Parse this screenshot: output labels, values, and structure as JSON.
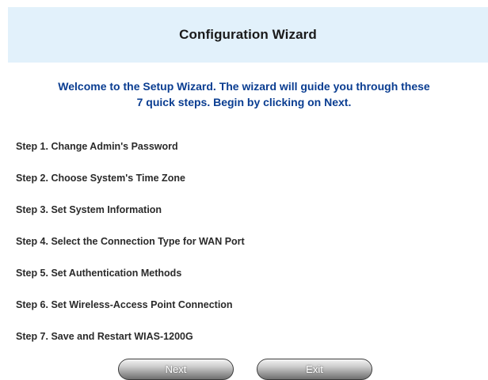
{
  "header": {
    "title": "Configuration Wizard"
  },
  "welcome": {
    "line1": "Welcome to the Setup Wizard. The wizard will guide you through these",
    "line2": "7 quick steps. Begin by clicking on Next."
  },
  "steps": [
    "Step 1. Change Admin's Password",
    "Step 2. Choose System's Time Zone",
    "Step 3. Set System Information",
    "Step 4. Select the Connection Type for WAN Port",
    "Step 5. Set Authentication Methods",
    "Step 6. Set Wireless-Access Point Connection",
    "Step 7. Save and Restart WIAS-1200G"
  ],
  "buttons": {
    "next_label": "Next",
    "exit_label": "Exit"
  },
  "colors": {
    "header_background": "#e2f1fb",
    "welcome_text": "#0a3d91"
  }
}
